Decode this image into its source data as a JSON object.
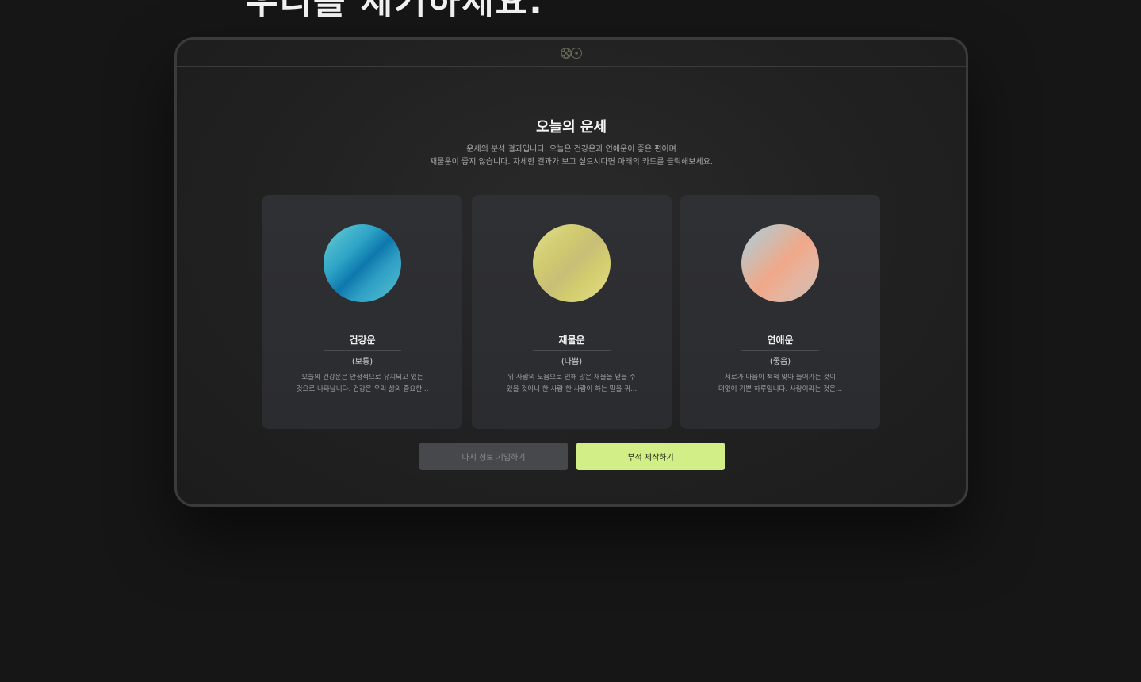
{
  "heading": "우리를 세기하세요.",
  "title": "오늘의 운세",
  "description": {
    "line1": "운세의 분석 결과입니다. 오늘은 건강운과 연애운이 좋은 편이며",
    "line2": "재물운이 좋지 않습니다. 자세한 결과가 보고 싶으시다면 아래의 카드를 클릭해보세요."
  },
  "cards": [
    {
      "title": "건강운",
      "status": "(보통)",
      "line1": "오늘의 건강운은 안정적으로 유지되고 있는",
      "line2": "것으로 나타납니다. 건강은 우리 삶의 중요한...",
      "colors": [
        "#6ad0d6",
        "#0e78ad"
      ]
    },
    {
      "title": "재물운",
      "status": "(나쁨)",
      "line1": "위 사람의 도움으로 인해 많은 재물을 얻을 수",
      "line2": "있을 것이니 한 사람 한 사람이 하는 말을 귀...",
      "colors": [
        "#e0e08a",
        "#c8be78"
      ]
    },
    {
      "title": "연애운",
      "status": "(좋음)",
      "line1": "서로가 마음이 척척 맞아 들어가는 것이",
      "line2": "더없이 기쁜 하루입니다. 사랑이라는 것은...",
      "colors": [
        "#a8d0e0",
        "#f0a888"
      ]
    }
  ],
  "buttons": {
    "retry": "다시 정보 기입하기",
    "make": "부적 제작하기"
  },
  "accent": "#d2ee87",
  "icons": {
    "logo": "clover-circle-logo-icon"
  }
}
